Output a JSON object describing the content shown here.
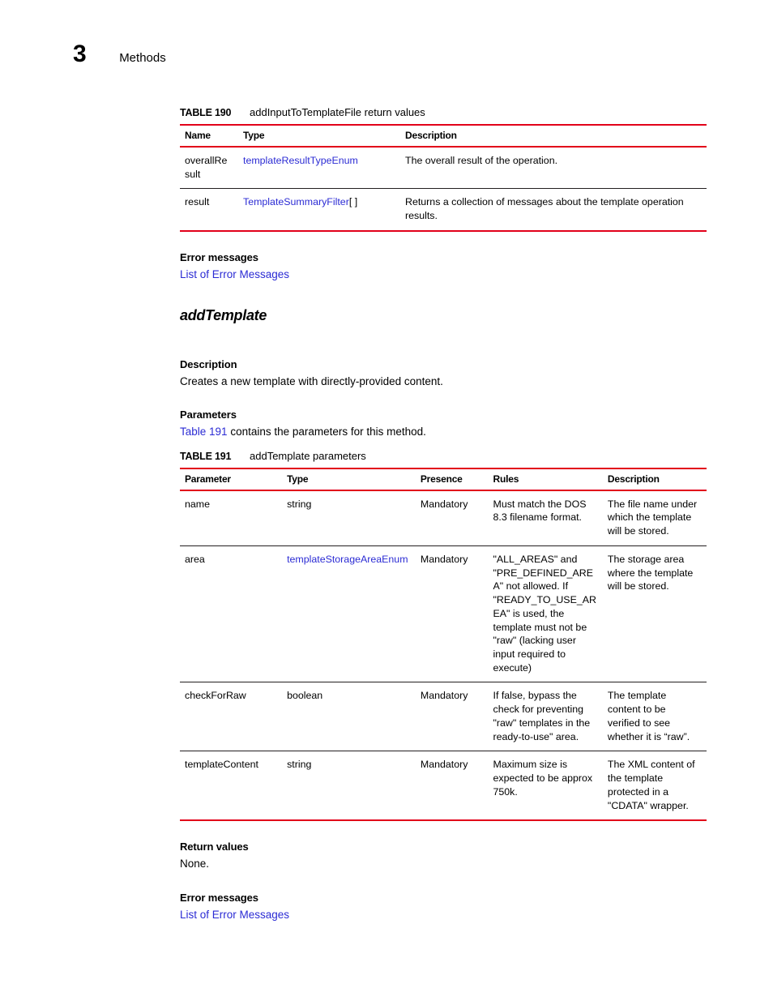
{
  "header": {
    "chapter_number": "3",
    "chapter_title": "Methods"
  },
  "colors": {
    "rule_red": "#e2001a",
    "link_blue": "#2b2bd4",
    "text_black": "#000000"
  },
  "table_190": {
    "caption_label": "TABLE 190",
    "caption_text": "addInputToTemplateFile return values",
    "columns": [
      "Name",
      "Type",
      "Description"
    ],
    "rows": [
      {
        "name": "overallRe\nsult",
        "type": "templateResultTypeEnum",
        "type_suffix": "",
        "description": "The overall result of the operation."
      },
      {
        "name": "result",
        "type": "TemplateSummaryFilter",
        "type_suffix": "[ ]",
        "description": "Returns a collection of messages about the template operation results."
      }
    ]
  },
  "section_error_messages_1": {
    "heading": "Error messages",
    "link": "List of Error Messages"
  },
  "method": {
    "name": "addTemplate",
    "description_heading": "Description",
    "description_text": "Creates a new template with directly-provided content.",
    "parameters_heading": "Parameters",
    "parameters_link": "Table 191",
    "parameters_rest": " contains the parameters for this method."
  },
  "table_191": {
    "caption_label": "TABLE 191",
    "caption_text": "addTemplate parameters",
    "columns": [
      "Parameter",
      "Type",
      "Presence",
      "Rules",
      "Description"
    ],
    "rows": [
      {
        "parameter": "name",
        "type": "string",
        "type_is_link": false,
        "presence": "Mandatory",
        "rules": "Must match the DOS 8.3 filename format.",
        "description": "The file name under which the template will be stored."
      },
      {
        "parameter": "area",
        "type": "templateStorageAreaEnum",
        "type_is_link": true,
        "presence": "Mandatory",
        "rules": "\"ALL_AREAS\" and \"PRE_DEFINED_ARE A\" not allowed. If \"READY_TO_USE_AR EA\" is used, the template must not be \"raw\" (lacking user input required to execute)",
        "description": "The storage area where the template will be stored."
      },
      {
        "parameter": "checkForRaw",
        "type": "boolean",
        "type_is_link": false,
        "presence": "Mandatory",
        "rules": "If false, bypass the check for preventing \"raw\" templates in the ready-to-use\" area.",
        "description": "The template content to be verified to see whether it is “raw”."
      },
      {
        "parameter": "templateContent",
        "type": "string",
        "type_is_link": false,
        "presence": "Mandatory",
        "rules": "Maximum size is expected to be approx 750k.",
        "description": "The XML content of the template protected in a \"CDATA\" wrapper."
      }
    ]
  },
  "section_return_values": {
    "heading": "Return values",
    "text": "None."
  },
  "section_error_messages_2": {
    "heading": "Error messages",
    "link": "List of Error Messages"
  }
}
